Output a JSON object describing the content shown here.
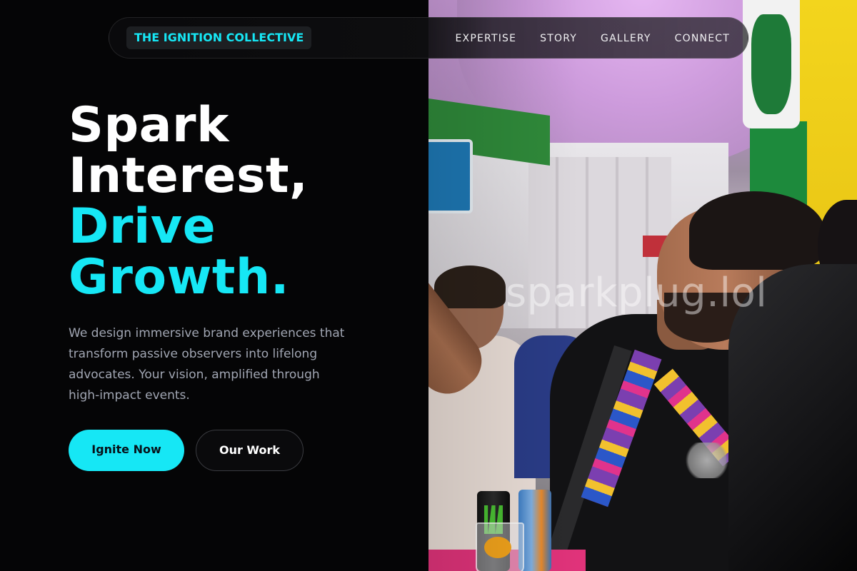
{
  "nav": {
    "brand": "THE IGNITION COLLECTIVE",
    "links": [
      {
        "label": "EXPERTISE"
      },
      {
        "label": "STORY"
      },
      {
        "label": "GALLERY"
      },
      {
        "label": "CONNECT"
      }
    ]
  },
  "hero": {
    "headline": {
      "line1": "Spark",
      "line2": "Interest,",
      "line3": "Drive",
      "line4": "Growth."
    },
    "description": "We design immersive brand experiences that transform passive observers into lifelong advocates. Your vision, amplified through high-impact events.",
    "primary_button": "Ignite Now",
    "secondary_button": "Our Work"
  },
  "photo": {
    "watermark": "sparkplug.lol"
  },
  "colors": {
    "accent": "#16e7f5",
    "background": "#050506",
    "body_text": "#a1a6b3"
  }
}
